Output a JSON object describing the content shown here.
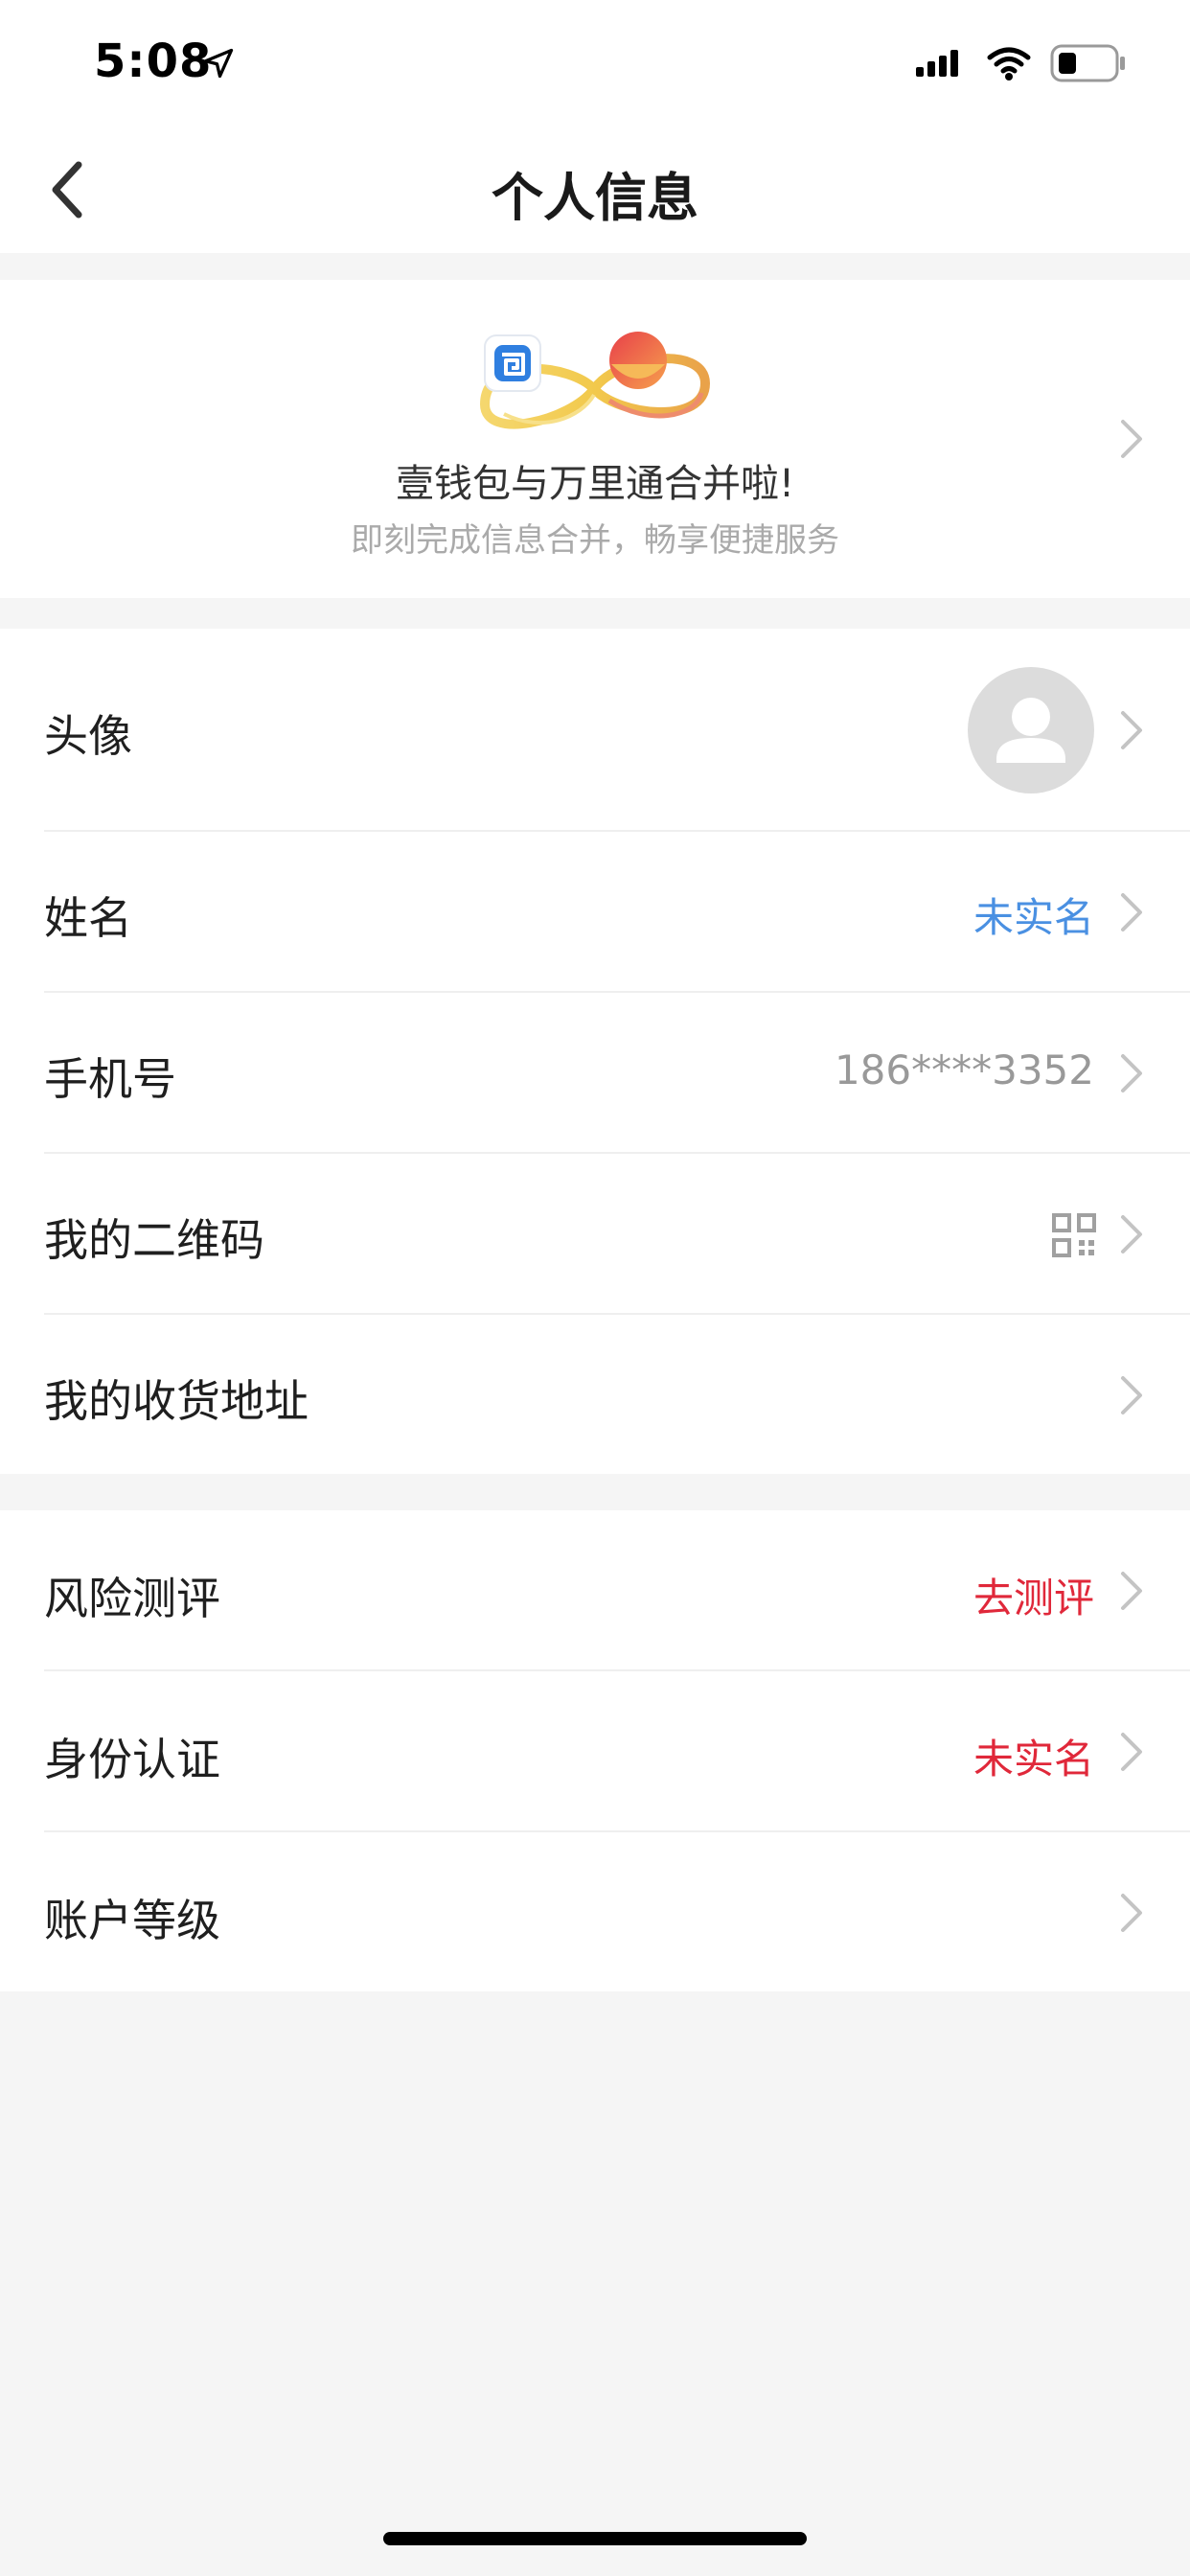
{
  "status_bar": {
    "time": "5:08"
  },
  "nav": {
    "title": "个人信息"
  },
  "banner": {
    "title": "壹钱包与万里通合并啦!",
    "subtitle": "即刻完成信息合并，畅享便捷服务"
  },
  "profile_items": [
    {
      "label": "头像",
      "value": ""
    },
    {
      "label": "姓名",
      "value": "未实名"
    },
    {
      "label": "手机号",
      "value": "186****3352"
    },
    {
      "label": "我的二维码",
      "value": ""
    },
    {
      "label": "我的收货地址",
      "value": ""
    }
  ],
  "account_items": [
    {
      "label": "风险测评",
      "value": "去测评"
    },
    {
      "label": "身份认证",
      "value": "未实名"
    },
    {
      "label": "账户等级",
      "value": ""
    }
  ],
  "colors": {
    "link_blue": "#4a90e2",
    "alert_red": "#e0283a",
    "muted_gray": "#999999",
    "page_bg": "#f5f5f5"
  }
}
